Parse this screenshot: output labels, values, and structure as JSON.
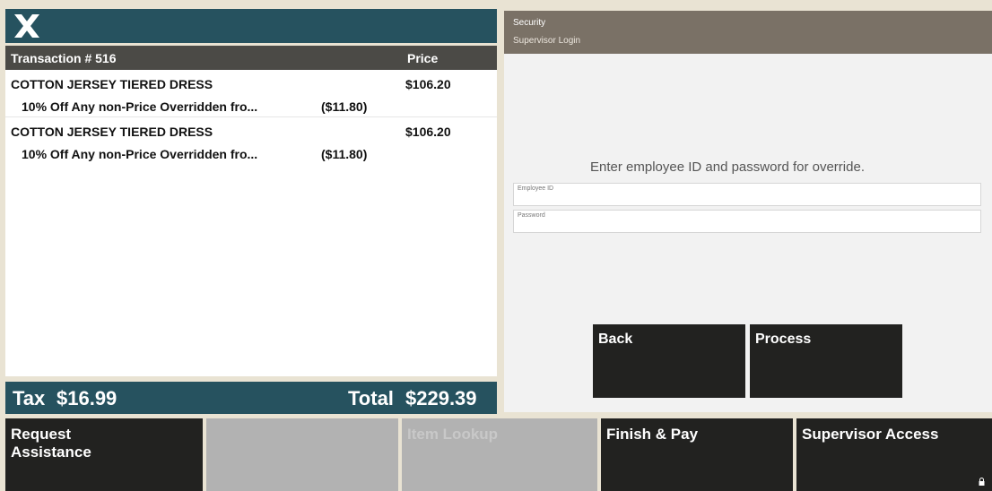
{
  "transaction": {
    "title": "Transaction # 516",
    "price_header": "Price",
    "items": [
      {
        "name": "COTTON JERSEY TIERED DRESS",
        "price": "$106.20",
        "discount": "10% Off Any non-Price Overridden fro...",
        "discount_amount": "($11.80)"
      },
      {
        "name": "COTTON JERSEY TIERED DRESS",
        "price": "$106.20",
        "discount": "10% Off Any non-Price Overridden fro...",
        "discount_amount": "($11.80)"
      }
    ],
    "tax_label": "Tax",
    "tax_value": "$16.99",
    "total_label": "Total",
    "total_value": "$229.39"
  },
  "security": {
    "title": "Security",
    "subtitle": "Supervisor Login",
    "prompt": "Enter employee ID and password for override.",
    "employee_id_label": "Employee ID",
    "employee_id_value": "",
    "password_label": "Password",
    "password_value": "",
    "back_label": "Back",
    "process_label": "Process"
  },
  "bottom_bar": {
    "request_assistance": "Request\nAssistance",
    "blank": "",
    "item_lookup": "Item Lookup",
    "finish_pay": "Finish & Pay",
    "supervisor_access": "Supervisor Access"
  },
  "colors": {
    "teal_header": "#26525f",
    "dark_header": "#4b4a46",
    "dark_button": "#222220",
    "disabled_button": "#b2b2b2",
    "security_header": "#7a7166",
    "background": "#e9e3d3"
  },
  "icons": {
    "logo": "x-logo-icon",
    "lock": "lock-icon"
  }
}
